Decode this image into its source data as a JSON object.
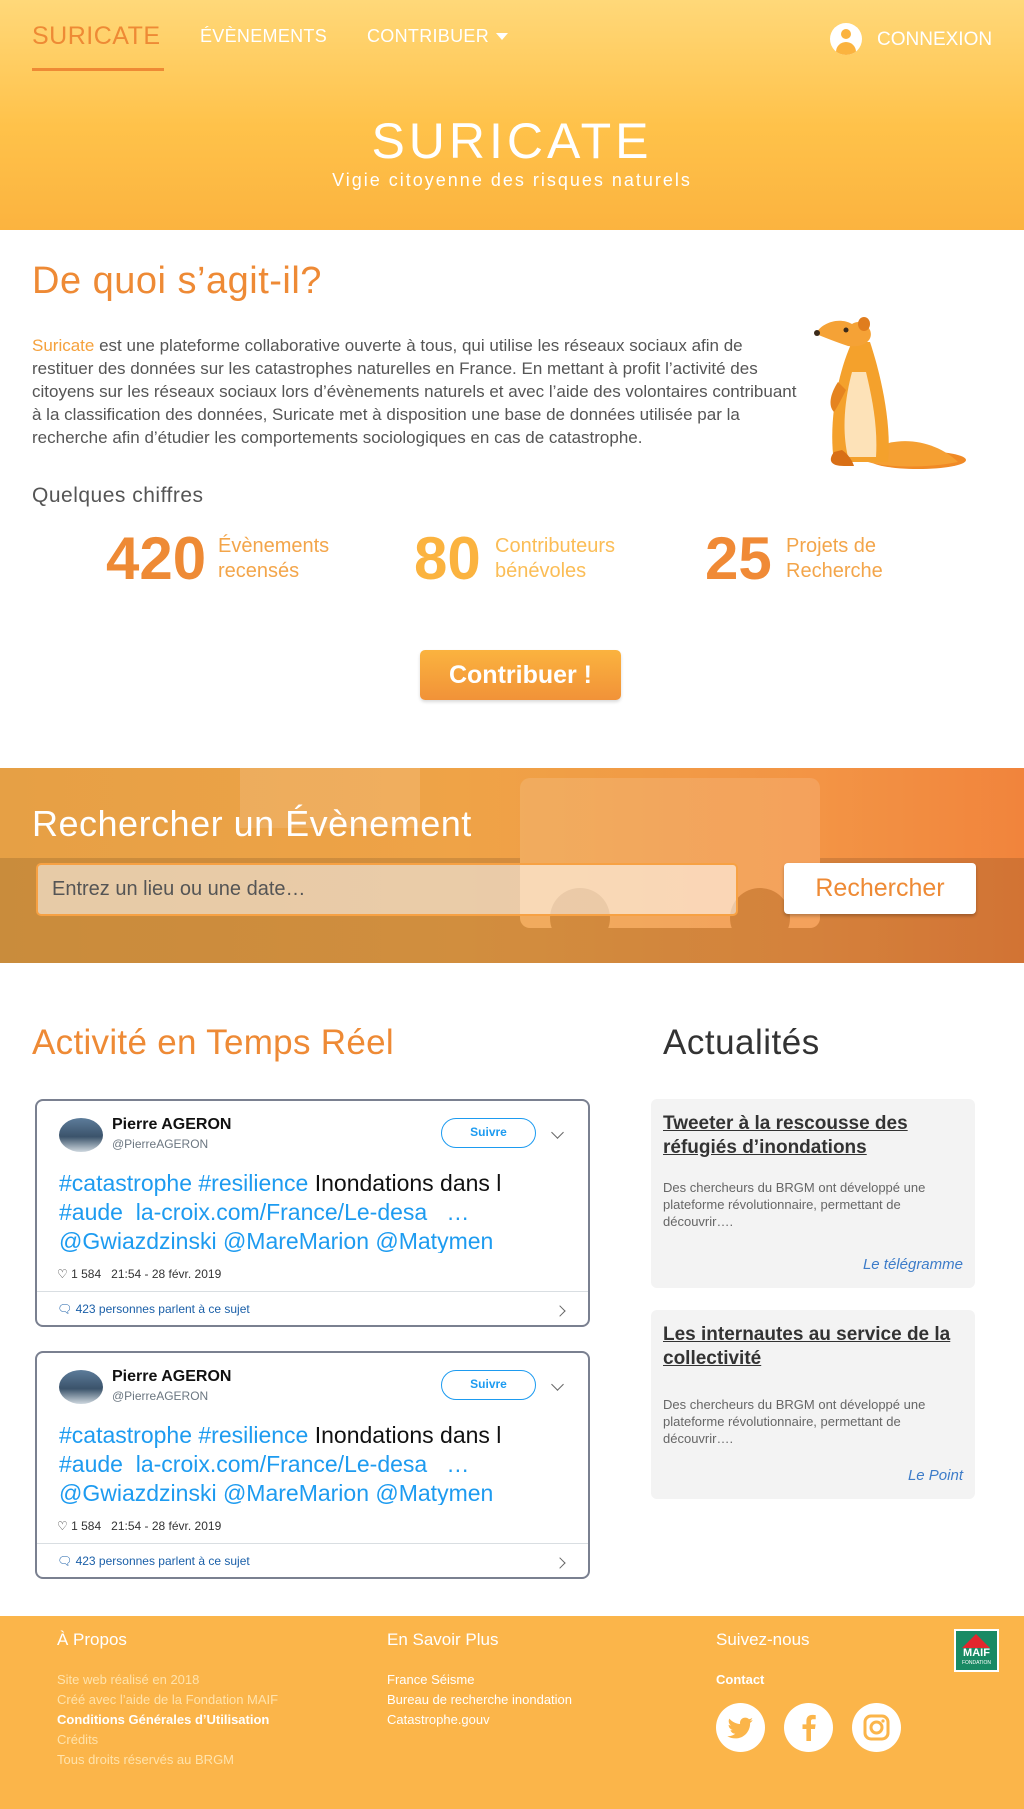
{
  "nav": {
    "brand": "SURICATE",
    "events": "ÉVÈNEMENTS",
    "contribute": "CONTRIBUER",
    "login": "CONNEXION"
  },
  "hero": {
    "title": "SURICATE",
    "subtitle": "Vigie citoyenne des risques naturels"
  },
  "about": {
    "title": "De quoi s’agit-il?",
    "highlight": "Suricate",
    "text": " est une plateforme collaborative ouverte à tous, qui utilise les réseaux sociaux afin de restituer des données sur les catastrophes naturelles en France. En mettant à profit l’activité des citoyens sur les réseaux sociaux lors d’évènements naturels et avec l’aide des volontaires contribuant à la classification des données, Suricate met à disposition une base de données utilisée par la recherche afin d’étudier les comportements sociologiques en cas de catastrophe."
  },
  "stats": {
    "title": "Quelques chiffres",
    "items": [
      {
        "value": "420",
        "label_line1": "Évènements",
        "label_line2": "recensés",
        "color": "#ee8a35"
      },
      {
        "value": "80",
        "label_line1": "Contributeurs",
        "label_line2": "bénévoles",
        "color": "#fbb33f"
      },
      {
        "value": "25",
        "label_line1": "Projets de",
        "label_line2": "Recherche",
        "color": "#f08a36"
      }
    ]
  },
  "contribute_button": "Contribuer !",
  "search": {
    "title": "Rechercher un Évènement",
    "placeholder": "Entrez un lieu ou une date…",
    "button": "Rechercher"
  },
  "activity": {
    "title": "Activité en Temps Réel",
    "tweets": [
      {
        "name": "Pierre AGERON",
        "handle": "@PierreAGERON",
        "follow": "Suivre",
        "tag1": "#catastrophe",
        "tag2": "#resilience",
        "text1": "Inondations dans l",
        "tag3": "#aude",
        "link": "la-croix.com/France/Le-desa",
        "ellipsis": "…",
        "mentions": "@Gwiazdzinski @MareMarion @Matymen",
        "likes": "1 584",
        "time": "21:54 - 28 févr. 2019",
        "replies": "423 personnes parlent à ce sujet"
      },
      {
        "name": "Pierre AGERON",
        "handle": "@PierreAGERON",
        "follow": "Suivre",
        "tag1": "#catastrophe",
        "tag2": "#resilience",
        "text1": "Inondations dans l",
        "tag3": "#aude",
        "link": "la-croix.com/France/Le-desa",
        "ellipsis": "…",
        "mentions": "@Gwiazdzinski @MareMarion @Matymen",
        "likes": "1 584",
        "time": "21:54 - 28 févr. 2019",
        "replies": "423 personnes parlent à ce sujet"
      }
    ]
  },
  "news": {
    "title": "Actualités",
    "items": [
      {
        "title": "Tweeter à la rescousse des réfugiés d’inondations",
        "text": "Des chercheurs du BRGM ont développé une plateforme révolutionnaire, permettant de découvrir….",
        "source": "Le télégramme"
      },
      {
        "title": "Les internautes au service de la collectivité",
        "text": "Des chercheurs du BRGM ont développé une plateforme révolutionnaire, permettant de découvrir….",
        "source": "Le Point"
      }
    ]
  },
  "footer": {
    "about": {
      "title": "À Propos",
      "links": [
        "Site web réalisé en 2018",
        "Créé avec l’aide de la Fondation MAIF",
        "Conditions Générales d’Utilisation",
        "Crédits",
        "Tous droits réservés au BRGM"
      ]
    },
    "more": {
      "title": "En Savoir Plus",
      "links": [
        "France Séisme",
        "Bureau de recherche inondation",
        "Catastrophe.gouv"
      ]
    },
    "follow": {
      "title": "Suivez-nous",
      "contact": "Contact",
      "icons": [
        "twitter-icon",
        "facebook-icon",
        "instagram-icon"
      ]
    },
    "maif": {
      "word": "MAIF",
      "sub": "FONDATION"
    }
  }
}
